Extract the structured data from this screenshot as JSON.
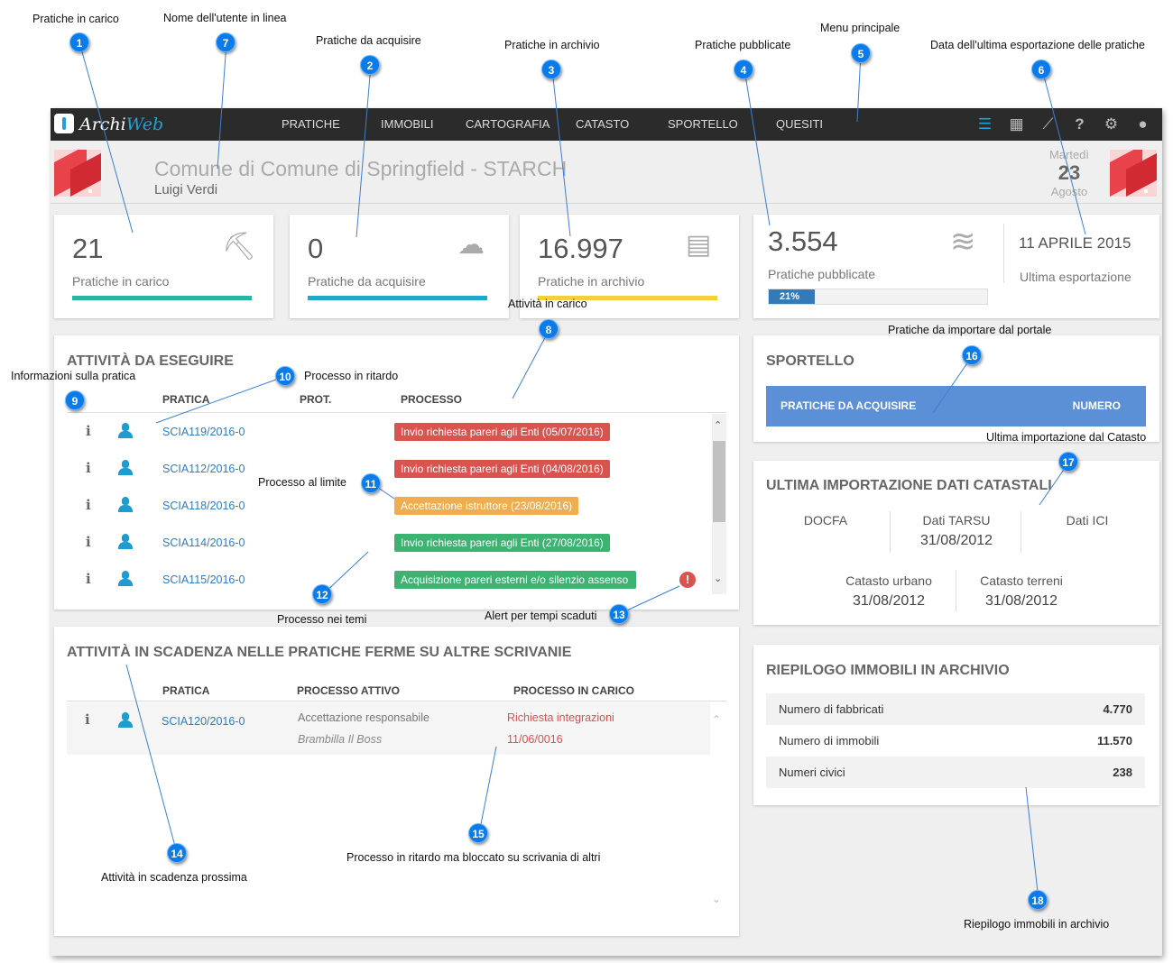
{
  "app": {
    "brand_archi": "Archi",
    "brand_web": "Web",
    "menu": [
      "PRATICHE",
      "IMMOBILI",
      "CARTOGRAFIA",
      "CATASTO",
      "SPORTELLO",
      "QUESITI"
    ],
    "toolbar_icons": [
      "list-icon",
      "calendar-icon",
      "chart-icon",
      "help-icon",
      "gear-icon",
      "user-icon"
    ]
  },
  "header": {
    "comune": "Comune di Comune di Springfield - STARCH",
    "user": "Luigi Verdi",
    "day_name": "Martedì",
    "day_num": "23",
    "month": "Agosto"
  },
  "stats": {
    "carico": {
      "value": "21",
      "label": "Pratiche in carico",
      "color": "#26b5a3"
    },
    "acquisire": {
      "value": "0",
      "label": "Pratiche da acquisire",
      "color": "#1fa9c6"
    },
    "archivio": {
      "value": "16.997",
      "label": "Pratiche in archivio",
      "color": "#f0d33a"
    },
    "pubblicate": {
      "value": "3.554",
      "label": "Pratiche pubblicate",
      "progress_label": "21%",
      "progress": 0.21
    },
    "export": {
      "date": "11 APRILE 2015",
      "label": "Ultima esportazione"
    }
  },
  "attivita": {
    "title": "ATTIVITÀ DA ESEGUIRE",
    "headers": [
      "PRATICA",
      "PROT.",
      "PROCESSO"
    ],
    "rows": [
      {
        "pratica": "SCIA119/2016-0",
        "processo": "Invio richiesta pareri agli Enti (05/07/2016)",
        "status": "red"
      },
      {
        "pratica": "SCIA112/2016-0",
        "processo": "Invio richiesta pareri agli Enti (04/08/2016)",
        "status": "red"
      },
      {
        "pratica": "SCIA118/2016-0",
        "processo": "Accettazione istruttore (23/08/2016)",
        "status": "orange"
      },
      {
        "pratica": "SCIA114/2016-0",
        "processo": "Invio richiesta pareri agli Enti (27/08/2016)",
        "status": "green"
      },
      {
        "pratica": "SCIA115/2016-0",
        "processo": "Acquisizione pareri esterni e/o silenzio assenso",
        "status": "green"
      }
    ]
  },
  "scadenza": {
    "title": "ATTIVITÀ IN SCADENZA NELLE PRATICHE FERME SU ALTRE SCRIVANIE",
    "headers": [
      "PRATICA",
      "PROCESSO ATTIVO",
      "PROCESSO IN CARICO"
    ],
    "row": {
      "pratica": "SCIA120/2016-0",
      "attivo": "Accettazione responsabile",
      "responsabile": "Brambilla Il Boss",
      "in_carico": "Richiesta integrazioni",
      "data": "11/06/0016"
    }
  },
  "sportello": {
    "title": "SPORTELLO",
    "col1": "PRATICHE DA ACQUISIRE",
    "col2": "NUMERO"
  },
  "catasto": {
    "title": "ULTIMA IMPORTAZIONE DATI CATASTALI",
    "docfa": "DOCFA",
    "tarsu_label": "Dati TARSU",
    "tarsu_date": "31/08/2012",
    "ici": "Dati ICI",
    "urbano_label": "Catasto urbano",
    "urbano_date": "31/08/2012",
    "terreni_label": "Catasto terreni",
    "terreni_date": "31/08/2012"
  },
  "riepilogo": {
    "title": "RIEPILOGO IMMOBILI IN ARCHIVIO",
    "rows": [
      {
        "label": "Numero di fabbricati",
        "value": "4.770"
      },
      {
        "label": "Numero di immobili",
        "value": "11.570"
      },
      {
        "label": "Numeri civici",
        "value": "238"
      }
    ]
  },
  "annotations": {
    "a1": "Pratiche in carico",
    "a2": "Pratiche da acquisire",
    "a3": "Pratiche in archivio",
    "a4": "Pratiche pubblicate",
    "a5": "Menu principale",
    "a6": "Data dell'ultima esportazione delle pratiche",
    "a7": "Nome dell'utente in linea",
    "a8": "Attività in carico",
    "a9": "Informazioni sulla pratica",
    "a10": "Processo in ritardo",
    "a11": "Processo al limite",
    "a12": "Processo nei temi",
    "a13": "Alert per tempi scaduti",
    "a14": "Attività in scadenza prossima",
    "a15": "Processo in ritardo ma bloccato su scrivania di altri",
    "a16": "Pratiche da importare dal portale",
    "a17": "Ultima importazione dal Catasto",
    "a18": "Riepilogo immobili in archivio"
  }
}
